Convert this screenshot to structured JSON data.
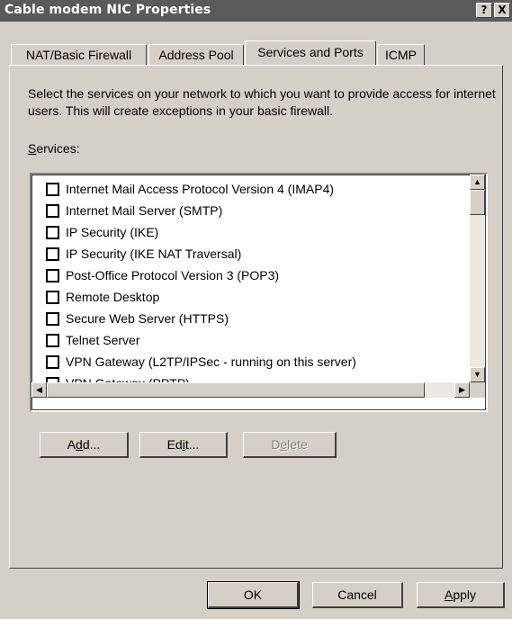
{
  "window": {
    "title": "Cable modem NIC Properties",
    "help_label": "?",
    "close_label": "X"
  },
  "tabs": [
    {
      "label": "NAT/Basic Firewall",
      "active": false
    },
    {
      "label": "Address Pool",
      "active": false
    },
    {
      "label": "Services and Ports",
      "active": true
    },
    {
      "label": "ICMP",
      "active": false
    }
  ],
  "page": {
    "description": "Select the services on your network to which you want to provide access for internet users.  This will create exceptions in your basic firewall.",
    "services_label": {
      "pre": "",
      "accel": "S",
      "post": "ervices:"
    }
  },
  "services": [
    {
      "label": "Internet Mail Access Protocol Version 4 (IMAP4)",
      "checked": false
    },
    {
      "label": "Internet Mail Server (SMTP)",
      "checked": false
    },
    {
      "label": "IP Security (IKE)",
      "checked": false
    },
    {
      "label": "IP Security (IKE NAT Traversal)",
      "checked": false
    },
    {
      "label": "Post-Office Protocol Version 3 (POP3)",
      "checked": false
    },
    {
      "label": "Remote Desktop",
      "checked": false
    },
    {
      "label": "Secure Web Server (HTTPS)",
      "checked": false
    },
    {
      "label": "Telnet Server",
      "checked": false
    },
    {
      "label": "VPN Gateway (L2TP/IPSec - running on this server)",
      "checked": false
    },
    {
      "label": "VPN Gateway (PPTP)",
      "checked": false
    }
  ],
  "list_buttons": {
    "add": {
      "pre": "A",
      "accel": "d",
      "post": "d..."
    },
    "edit": {
      "pre": "Ed",
      "accel": "i",
      "post": "t..."
    },
    "delete": {
      "pre": "D",
      "accel": "e",
      "post": "lete"
    }
  },
  "footer": {
    "ok": "OK",
    "cancel": "Cancel",
    "apply": {
      "pre": "",
      "accel": "A",
      "post": "pply"
    }
  },
  "scrollbars": {
    "up_icon": "▲",
    "down_icon": "▼",
    "left_icon": "◀",
    "right_icon": "▶"
  }
}
